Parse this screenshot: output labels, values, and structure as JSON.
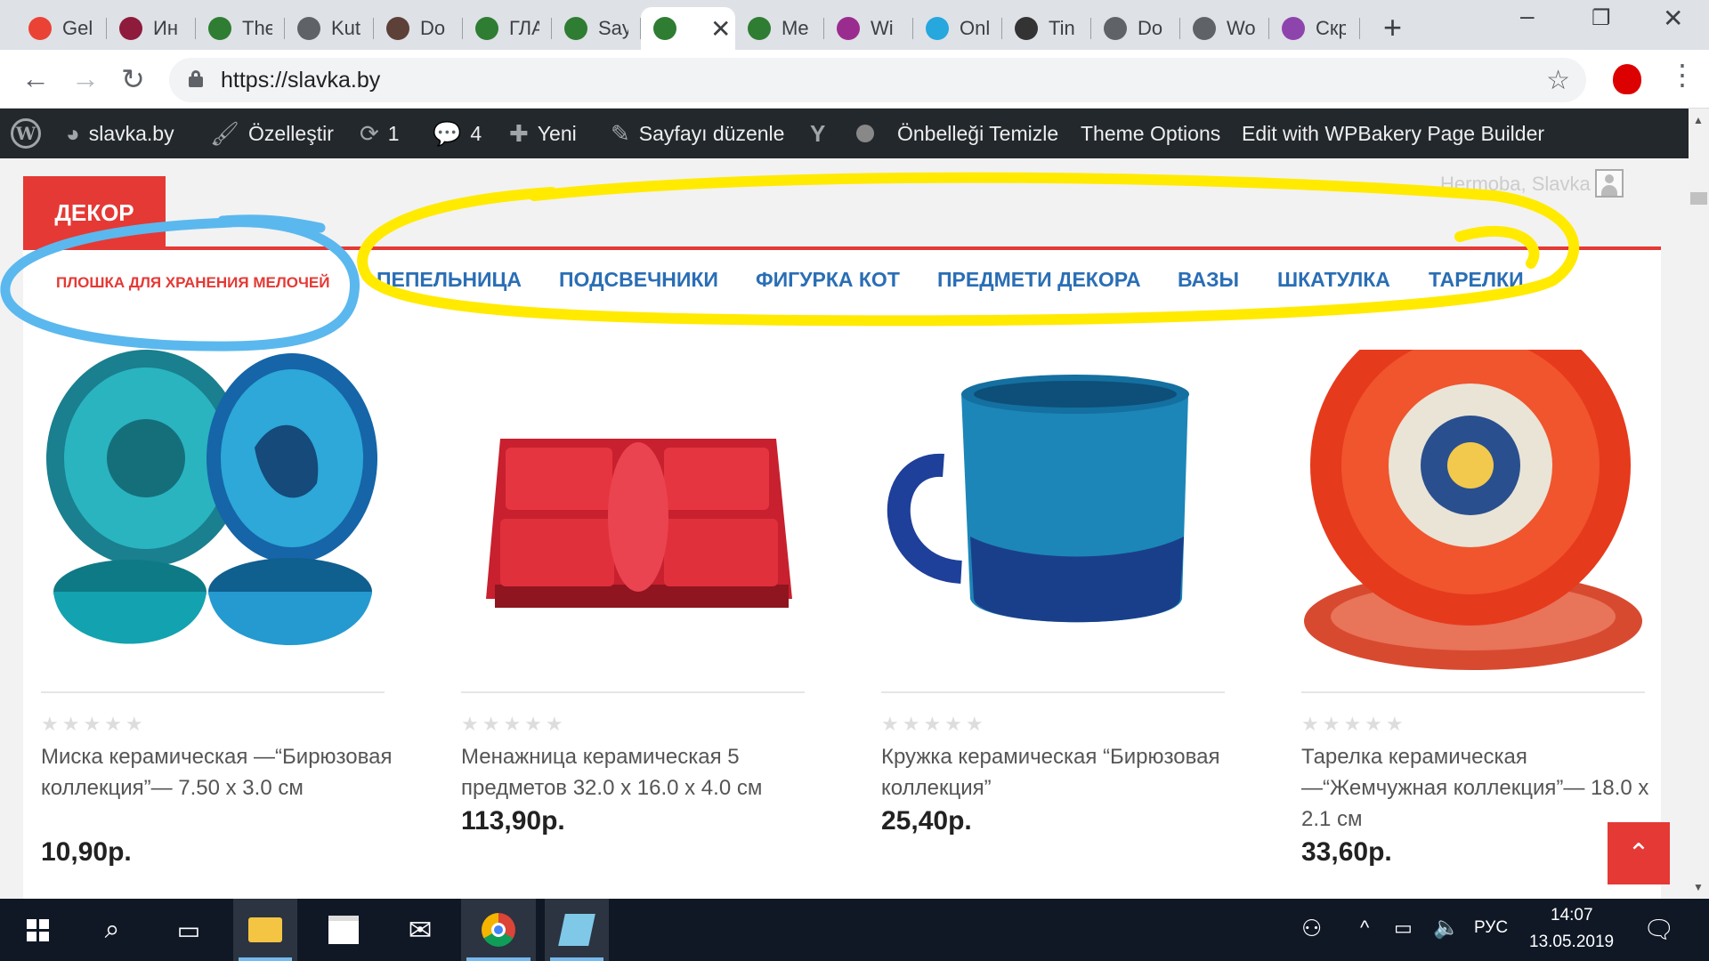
{
  "browser": {
    "tabs": [
      {
        "title": "Gel",
        "icon": "gmail-icon",
        "color": "#ea4335"
      },
      {
        "title": "Ин",
        "icon": "shield-icon",
        "color": "#8e1b3c"
      },
      {
        "title": "The",
        "icon": "grid-icon",
        "color": "#2e7d32"
      },
      {
        "title": "Kut",
        "icon": "globe-icon",
        "color": "#5f6368"
      },
      {
        "title": "Do",
        "icon": "book-icon",
        "color": "#5d4037"
      },
      {
        "title": "ГЛА",
        "icon": "grid-icon",
        "color": "#2e7d32"
      },
      {
        "title": "Say",
        "icon": "grid-icon",
        "color": "#2e7d32"
      },
      {
        "title": "",
        "icon": "grid-icon",
        "color": "#2e7d32",
        "active": true
      },
      {
        "title": "Me",
        "icon": "grid-icon",
        "color": "#2e7d32"
      },
      {
        "title": "Wi",
        "icon": "woo-icon",
        "color": "#9b2c8f"
      },
      {
        "title": "Onl",
        "icon": "spiral-icon",
        "color": "#26a7de"
      },
      {
        "title": "Tin",
        "icon": "panda-icon",
        "color": "#333333"
      },
      {
        "title": "Do",
        "icon": "globe-icon",
        "color": "#5f6368"
      },
      {
        "title": "Wo",
        "icon": "globe-icon",
        "color": "#5f6368"
      },
      {
        "title": "Скр",
        "icon": "feather-icon",
        "color": "#8e44ad"
      }
    ],
    "url": "https://slavka.by"
  },
  "adminbar": {
    "site": "slavka.by",
    "customize": "Özelleştir",
    "updates": "1",
    "comments": "4",
    "new": "Yeni",
    "edit_page": "Sayfayı düzenle",
    "clear_cache": "Önbelleği Temizle",
    "theme_options": "Theme Options",
    "wpbakery": "Edit with WPBakery Page Builder"
  },
  "page": {
    "category_badge": "ДЕКОР",
    "greeting": "Hermoba, Slavka",
    "categories": [
      "ПЛОШКА ДЛЯ ХРАНЕНИЯ МЕЛОЧЕЙ",
      "ПЕПЕЛЬНИЦА",
      "ПОДСВЕЧНИКИ",
      "ФИГУРКА КОТ",
      "ПРЕДМЕТИ ДЕКОРА",
      "ВАЗЫ",
      "ШКАТУЛКА",
      "ТАРЕЛКИ"
    ],
    "products": [
      {
        "name": "Миска керамическая —“Бирюзовая коллекция”— 7.50 x 3.0 см",
        "price": "10,90р.",
        "rating": 0
      },
      {
        "name": "Менажница керамическая 5 предметов 32.0 x 16.0 x 4.0 см",
        "price": "113,90р.",
        "rating": 0
      },
      {
        "name": "Кружка керамическая “Бирюзовая коллекция”",
        "price": "25,40р.",
        "rating": 0
      },
      {
        "name": "Тарелка керамическая —“Жемчужная коллекция”— 18.0 x 2.1 см",
        "price": "33,60р.",
        "rating": 0
      }
    ],
    "accent_color": "#e53935",
    "link_color": "#2a6eb5"
  },
  "annotations": {
    "blue_circle_color": "#5ab8ee",
    "yellow_circle_color": "#ffea00"
  },
  "taskbar": {
    "language": "РУС",
    "time": "14:07",
    "date": "13.05.2019"
  }
}
